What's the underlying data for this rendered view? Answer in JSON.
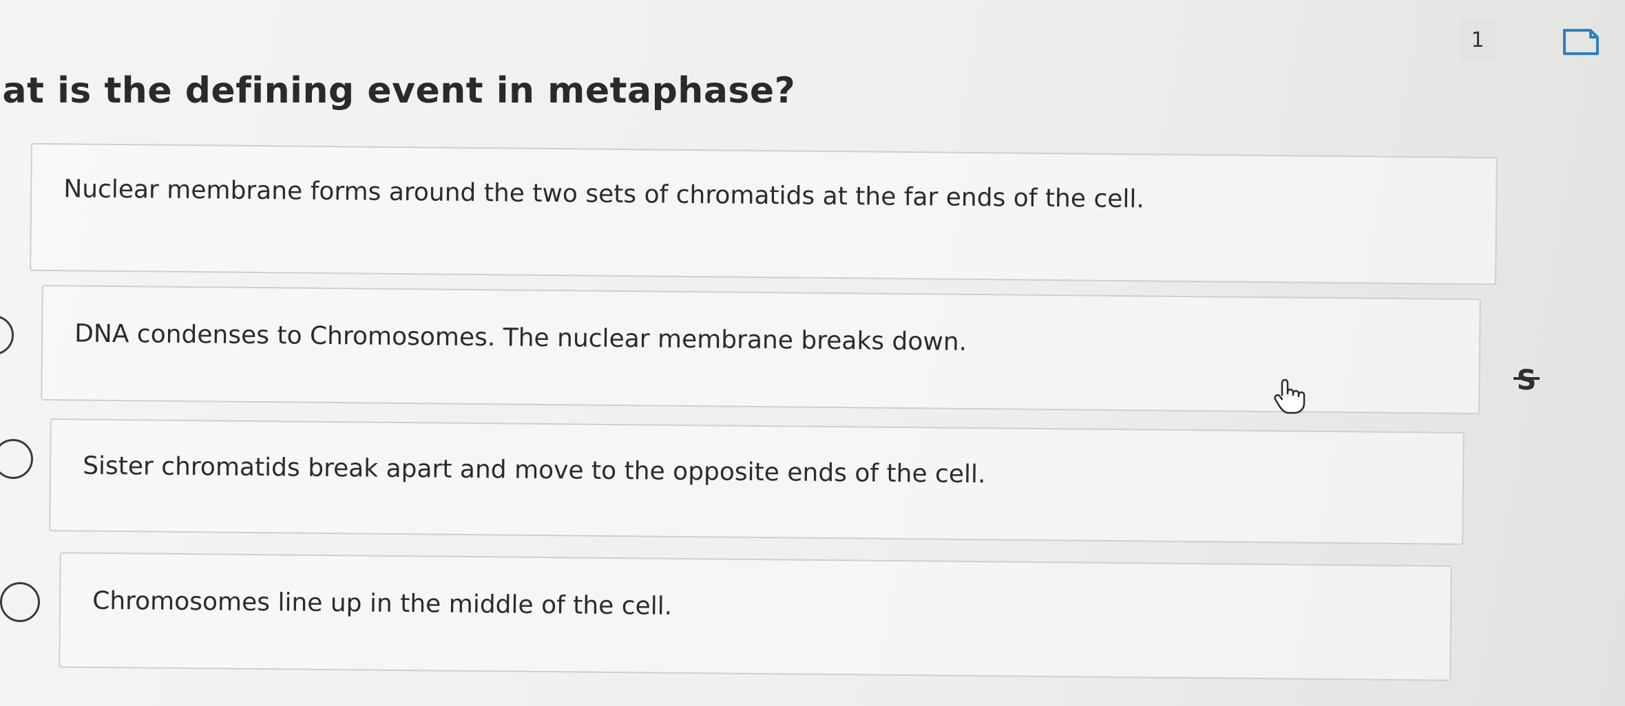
{
  "question": {
    "number": "1",
    "text": "hat is the defining event in metaphase?"
  },
  "answers": [
    {
      "text": "Nuclear membrane forms around the two sets of chromatids at the far ends of the cell."
    },
    {
      "text": "DNA condenses to Chromosomes.  The nuclear membrane breaks down."
    },
    {
      "text": "Sister chromatids break apart and move to the opposite ends of the cell."
    },
    {
      "text": "Chromosomes line up in the middle of the cell."
    }
  ],
  "icons": {
    "bookmark": "bookmark-icon",
    "strikethrough": "strikethrough-icon",
    "cursor": "hand-pointer-cursor"
  },
  "colors": {
    "border": "#cfd0ce",
    "text": "#2b2b2b",
    "radio": "#3a3a3a"
  }
}
